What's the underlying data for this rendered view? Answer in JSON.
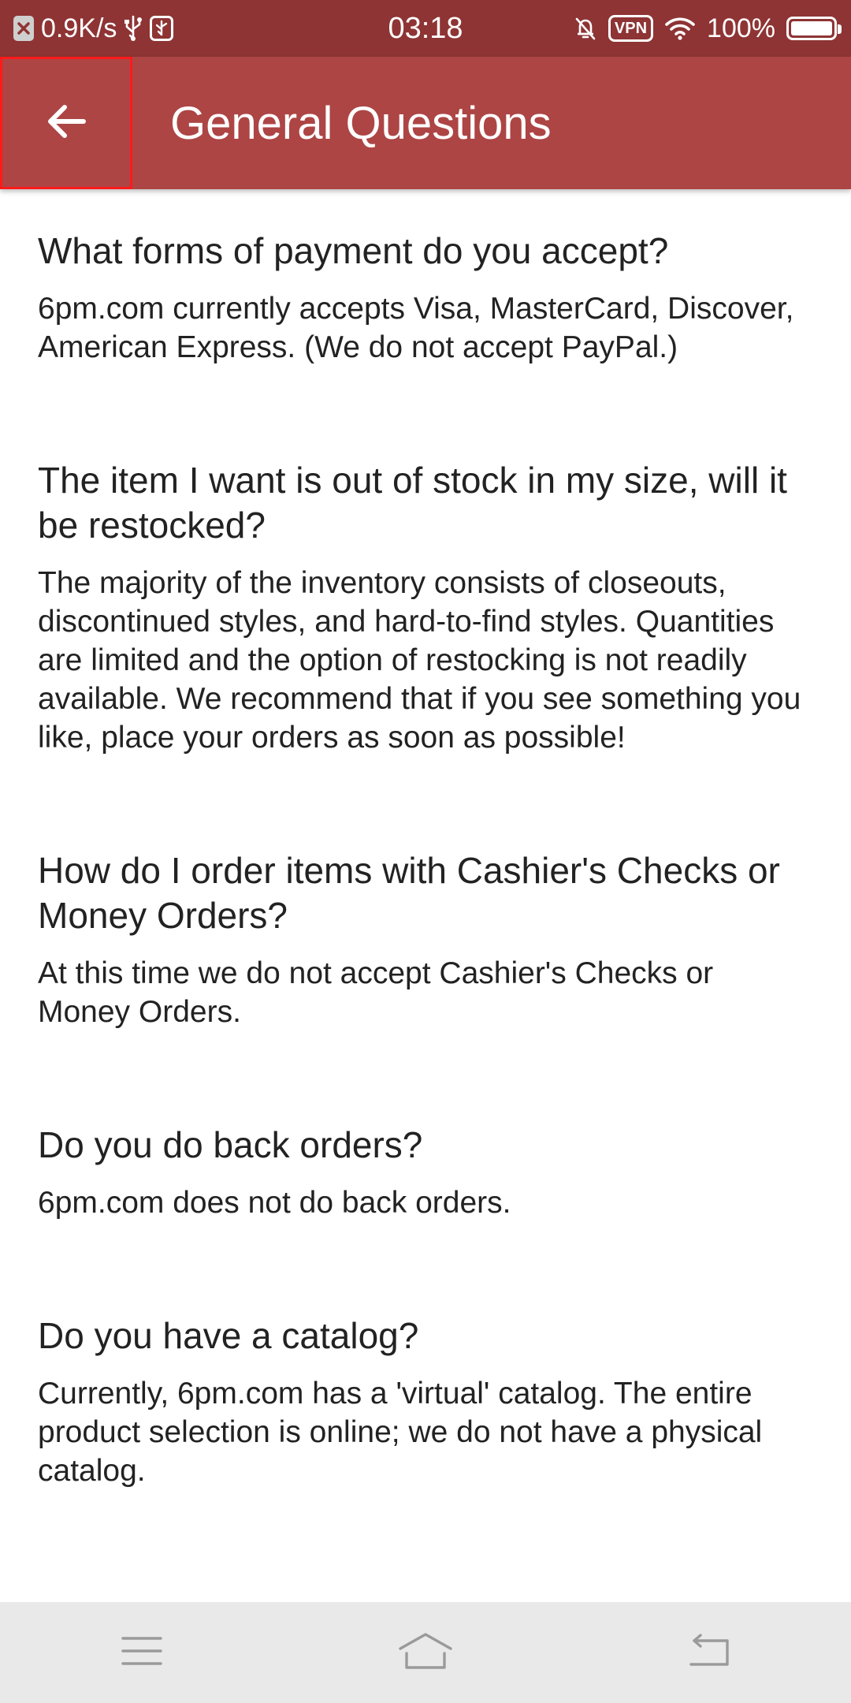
{
  "status_bar": {
    "speed": "0.9K/s",
    "time": "03:18",
    "vpn": "VPN",
    "battery": "100%",
    "battery_level": 1.0,
    "icons": [
      "close-notification-icon",
      "usb-icon",
      "usb-debug-icon",
      "mute-icon",
      "vpn-icon",
      "wifi-icon",
      "battery-icon"
    ]
  },
  "app_bar": {
    "title": "General Questions",
    "back_icon": "arrow-back-icon",
    "color": "#ad4545"
  },
  "faqs": [
    {
      "question": "What forms of payment do you accept?",
      "answer": "6pm.com currently accepts Visa, MasterCard, Discover, American Express. (We do not accept PayPal.)"
    },
    {
      "question": "The item I want is out of stock in my size, will it be restocked?",
      "answer": "The majority of the inventory consists of closeouts, discontinued styles, and hard-to-find styles. Quantities are limited and the option of restocking is not readily available. We recommend that if you see something you like, place your orders as soon as possible!"
    },
    {
      "question": "How do I order items with Cashier's Checks or Money Orders?",
      "answer": "At this time we do not accept Cashier's Checks or Money Orders."
    },
    {
      "question": "Do you do back orders?",
      "answer": "6pm.com does not do back orders."
    },
    {
      "question": "Do you have a catalog?",
      "answer": "Currently, 6pm.com has a 'virtual' catalog. The entire product selection is online; we do not have a physical catalog."
    }
  ],
  "nav_bar": {
    "icons": [
      "menu-icon",
      "home-icon",
      "back-nav-icon"
    ]
  }
}
